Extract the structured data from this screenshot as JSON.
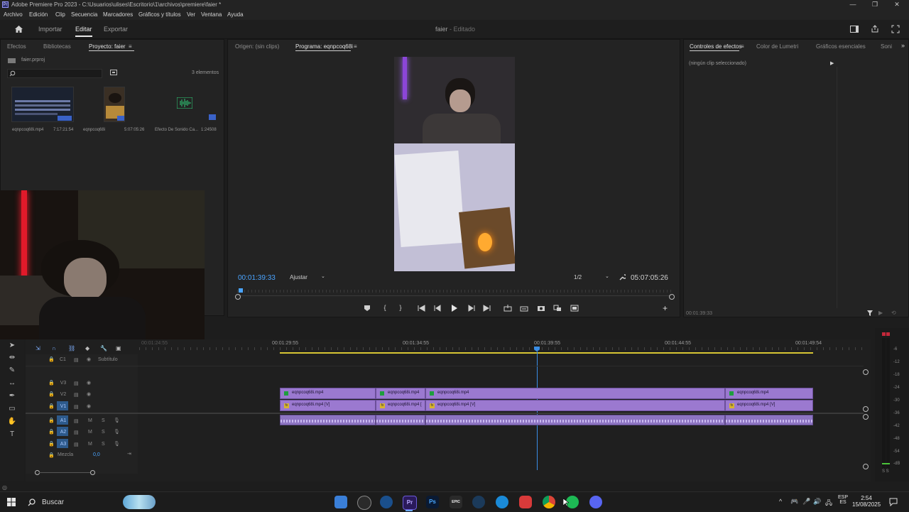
{
  "title_bar": {
    "app_icon": "Pr",
    "title": "Adobe Premiere Pro 2023 - C:\\Usuarios\\ulises\\Escritorio\\1\\archivos\\premiere\\faier *",
    "minimize": "—",
    "restore": "❐",
    "close": "✕"
  },
  "menu": [
    "Archivo",
    "Edición",
    "Clip",
    "Secuencia",
    "Marcadores",
    "Gráficos y títulos",
    "Ver",
    "Ventana",
    "Ayuda"
  ],
  "workspace": {
    "tabs": [
      "Importar",
      "Editar",
      "Exportar"
    ],
    "active": "Editar",
    "project_title": "faier",
    "status": "- Editado"
  },
  "project_panel": {
    "tabs": [
      "Efectos",
      "Bibliotecas",
      "Proyecto: faier"
    ],
    "file": "faier.prproj",
    "count": "3 elementos",
    "items": [
      {
        "name": "eqnpcoq68i.mp4",
        "duration": "7:17:21:54"
      },
      {
        "name": "eqnpcoq68i",
        "duration": "5:07:05:26"
      },
      {
        "name": "Efecto De Sonido Ca...",
        "duration": "1:24508"
      }
    ]
  },
  "source_tab": "Origen: (sin clips)",
  "program_monitor": {
    "tab": "Programa: eqnpcoq68i",
    "timecode": "00:01:39:33",
    "fit": "Ajustar",
    "resolution": "1/2",
    "duration": "05:07:05:26",
    "playhead_progress": 0.003
  },
  "effect_controls": {
    "tabs": [
      "Controles de efectos",
      "Color de Lumetri",
      "Gráficos esenciales",
      "Soni"
    ],
    "empty_text": "(ningún clip seleccionado)",
    "timecode": "00:01:39:33"
  },
  "timeline": {
    "ruler": [
      "00:01:24:55",
      "00:01:29:55",
      "00:01:34:55",
      "00:01:39:55",
      "00:01:44:55",
      "00:01:49:54"
    ],
    "subtitle_track": "Subtítulo",
    "video_tracks": [
      "V3",
      "V2",
      "V1"
    ],
    "audio_tracks": [
      "A1",
      "A2",
      "A3"
    ],
    "track_m": "M",
    "track_s": "S",
    "mix_label": "Mezcla",
    "mix_value": "0,0",
    "clip_v2": "eqnpcoq68i.mp4",
    "clip_v1": "eqnpcoq68i.mp4 [V]",
    "clip_v1_short": "eqnpcoq68i.mp4 [",
    "meter_scale": [
      "-6",
      "-12",
      "-18",
      "-24",
      "-30",
      "-36",
      "-42",
      "-48",
      "-54",
      "-dB"
    ],
    "meter_solo": "S S"
  },
  "taskbar": {
    "search": "Buscar",
    "apps": [
      "Pr",
      "Ps",
      "EPIC"
    ],
    "lang": "ESP",
    "lang2": "ES",
    "time": "2:54",
    "date": "15/08/2025"
  },
  "colors": {
    "accent_blue": "#4aa4ff",
    "clip_purple": "#9b79d0",
    "playhead": "#3a8ee6"
  }
}
